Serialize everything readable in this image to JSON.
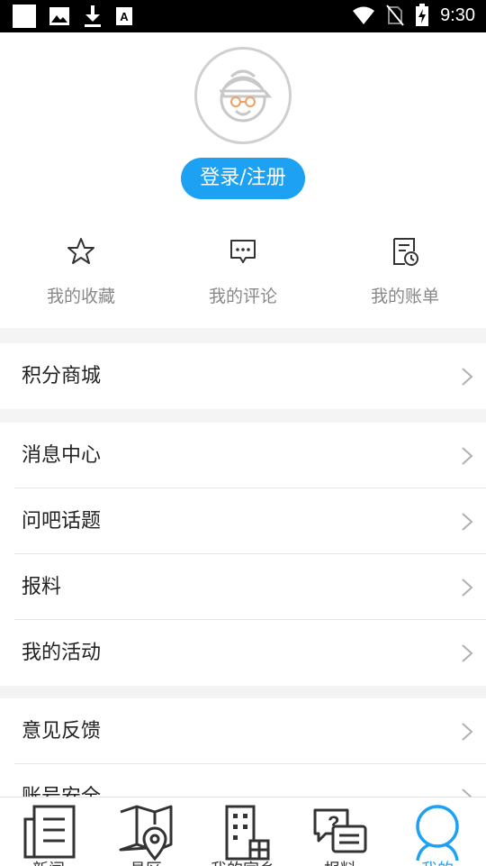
{
  "status_bar": {
    "time": "9:30",
    "left_icons": [
      "square-icon",
      "image-icon",
      "download-icon",
      "font-icon"
    ],
    "right_icons": [
      "wifi-icon",
      "no-sim-icon",
      "battery-charging-icon"
    ]
  },
  "profile": {
    "avatar_icon": "cartoon-grandpa-avatar",
    "login_label": "登录/注册"
  },
  "quick_actions": [
    {
      "label": "我的收藏",
      "icon": "star-icon"
    },
    {
      "label": "我的评论",
      "icon": "comment-icon"
    },
    {
      "label": "我的账单",
      "icon": "bill-clock-icon"
    }
  ],
  "menu_groups": [
    {
      "items": [
        {
          "label": "积分商城"
        }
      ]
    },
    {
      "items": [
        {
          "label": "消息中心"
        },
        {
          "label": "问吧话题"
        },
        {
          "label": "报料"
        },
        {
          "label": "我的活动"
        }
      ]
    },
    {
      "items": [
        {
          "label": "意见反馈"
        },
        {
          "label": "账号安全"
        }
      ]
    }
  ],
  "tabs": [
    {
      "label": "新闻",
      "icon": "newspaper-icon",
      "active": false
    },
    {
      "label": "县区",
      "icon": "map-pin-icon",
      "active": false
    },
    {
      "label": "我的家乡",
      "icon": "building-icon",
      "active": false
    },
    {
      "label": "报料",
      "icon": "question-chat-icon",
      "active": false
    },
    {
      "label": "我的",
      "icon": "user-icon",
      "active": true
    }
  ],
  "colors": {
    "accent": "#1da1f2",
    "muted_text": "#888888",
    "background": "#f4f4f4"
  }
}
